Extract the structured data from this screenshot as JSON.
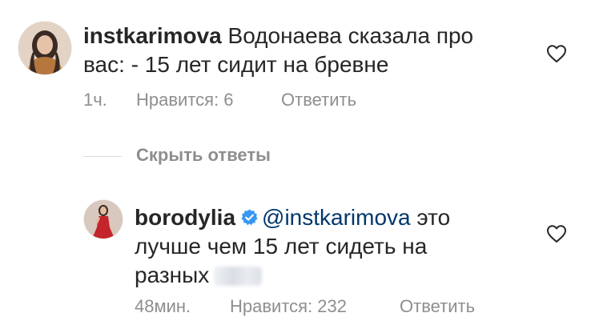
{
  "comments": [
    {
      "username": "instkarimova",
      "text_lines": [
        "Водонаева сказала про",
        "вас: - 15 лет сидит на бревне"
      ],
      "time": "1ч.",
      "likes": "Нравится: 6",
      "reply": "Ответить"
    },
    {
      "username": "borodylia",
      "verified": true,
      "mention": "@instkarimova",
      "text_parts": [
        " это",
        "лучше чем 15 лет сидеть на",
        "разных"
      ],
      "time": "48мин.",
      "likes": "Нравится: 232",
      "reply": "Ответить"
    }
  ],
  "hide_replies": "Скрыть ответы",
  "colors": {
    "text": "#262626",
    "meta": "#8e8e8e",
    "mention": "#00376b",
    "verified": "#3897f0"
  },
  "icons": {
    "like": "heart-outline-icon",
    "verified": "verified-badge-icon"
  }
}
